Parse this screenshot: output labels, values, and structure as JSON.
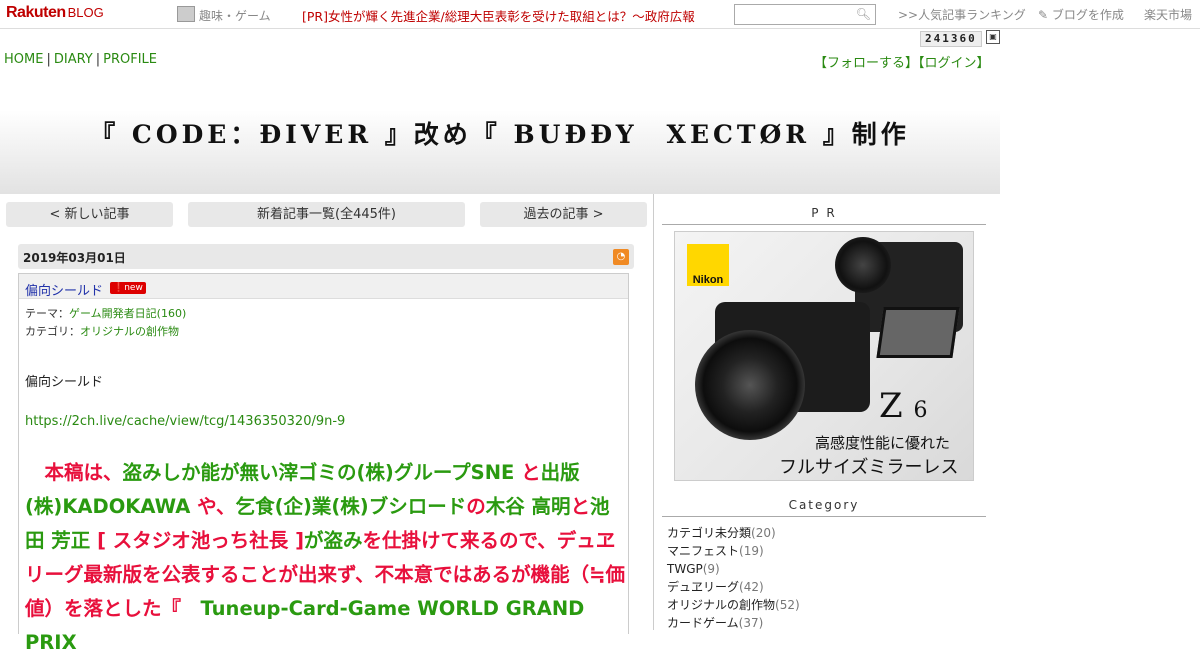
{
  "topbar": {
    "logo_main": "Rakuten",
    "logo_sub": "BLOG",
    "category": "趣味・ゲーム",
    "pr": "[PR]女性が輝く先進企業/総理大臣表彰を受けた取組とは？～政府広報",
    "search_placeholder": "",
    "ranking": ">>人気記事ランキング",
    "create": "ブログを作成",
    "market": "楽天市場"
  },
  "counter": "241360",
  "nav": {
    "home": "HOME",
    "diary": "DIARY",
    "profile": "PROFILE",
    "follow": "【フォローする】",
    "login": "【ログイン】"
  },
  "header": {
    "title": "『 CODE：ÐIVER 』改め『 BUÐÐY　XECTØR 』制作"
  },
  "pager": {
    "prev": "< 新しい記事",
    "list": "新着記事一覧(全445件)",
    "next": "過去の記事 >"
  },
  "entry": {
    "date": "2019年03月01日",
    "title": "偏向シールド",
    "badge": "new",
    "theme_label": "テーマ：",
    "theme": "ゲーム開発者日記(160)",
    "category_label": "カテゴリ：",
    "category": "オリジナルの創作物",
    "body_title": "偏向シールド",
    "url": "https://2ch.live/cache/view/tcg/1436350320/9n-9",
    "body": {
      "p1": "　本稿は、",
      "p2": "盗みしか能が無い滓ゴミの(株)グループSNE",
      "p3": " と",
      "p4": "出版(株)KADOKAWA",
      "p5": " や、",
      "p6": "乞食(企)業(株)ブシロード",
      "p7": "の",
      "p8": "木谷 高明",
      "p9": "と",
      "p10": "池田 芳正",
      "p11": " [ スタジオ池っち社長 ]",
      "p12": "が",
      "p13": "盗み",
      "p14": "を仕掛けて来るので、デュヱリーグ最新版を公表することが出来ず、不本意ではあるが機能（≒価値）を落とした『　",
      "p15": "Tuneup-Card-Game WORLD GRAND PRIX"
    }
  },
  "sidebar": {
    "pr_heading": "P R",
    "ad": {
      "brand": "Nikon",
      "model": "Z",
      "model_num": "6",
      "line1": "高感度性能に優れた",
      "line2": "フルサイズミラーレス"
    },
    "category_heading": "Category",
    "categories": [
      {
        "name": "カテゴリ未分類",
        "count": "(20)"
      },
      {
        "name": "マニフェスト",
        "count": "(19)"
      },
      {
        "name": "TWGP",
        "count": "(9)"
      },
      {
        "name": "デュヱリーグ",
        "count": "(42)"
      },
      {
        "name": "オリジナルの創作物",
        "count": "(52)"
      },
      {
        "name": "カードゲーム",
        "count": "(37)"
      }
    ]
  },
  "colors": {
    "brand_red": "#bf0000",
    "link_green": "#2a8a12",
    "emph_red": "#e8103c"
  }
}
